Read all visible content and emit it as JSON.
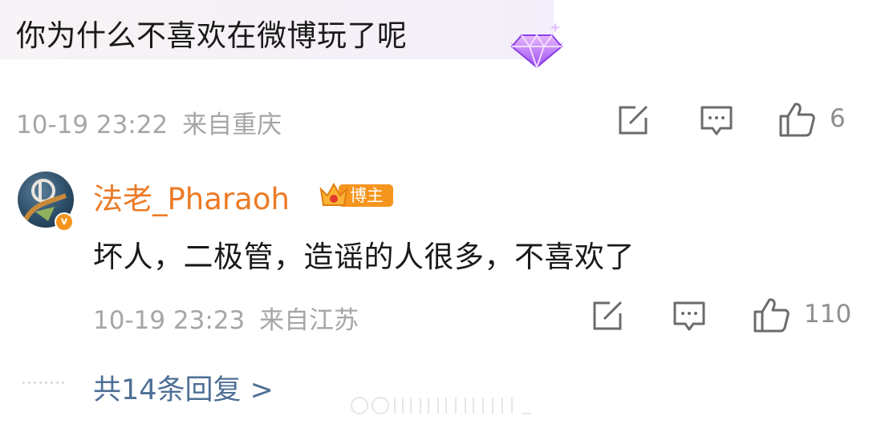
{
  "comment": {
    "text": "你为什么不喜欢在微博玩了呢",
    "badge_icon": "diamond-gem-badge-icon",
    "timestamp": "10-19 23:22",
    "location": "来自重庆",
    "like_count": "6"
  },
  "reply": {
    "username": "法老_Pharaoh",
    "verified_icon": "v",
    "role_badge": "博主",
    "text": "坏人，二极管，造谣的人很多，不喜欢了",
    "timestamp": "10-19 23:23",
    "location": "来自江苏",
    "like_count": "110"
  },
  "footer": {
    "more_replies": "共14条回复 >"
  },
  "colors": {
    "username": "#ec7a25",
    "link": "#4e6f96",
    "meta": "#a6a6a6",
    "badge_orange": "#f5951d"
  }
}
